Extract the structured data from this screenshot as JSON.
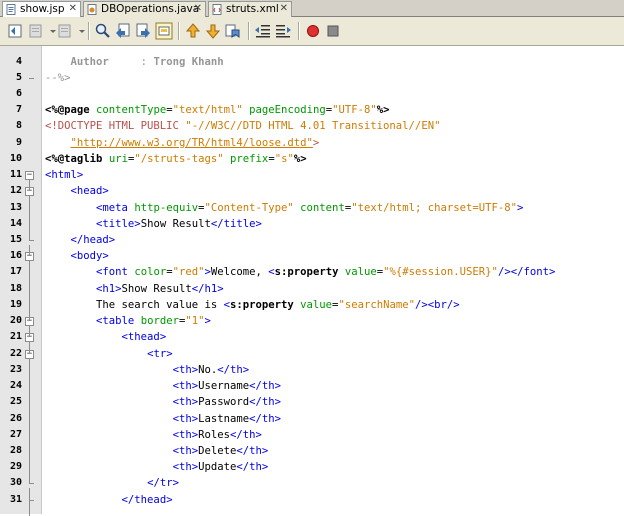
{
  "tabs": [
    {
      "label": "show.jsp",
      "active": true
    },
    {
      "label": "DBOperations.java",
      "active": false
    },
    {
      "label": "struts.xml",
      "active": false
    }
  ],
  "toolbar_icons": [
    "back-icon",
    "forward-icon",
    "down-arrow-icon",
    "find-icon",
    "find-prev-icon",
    "find-next-icon",
    "toggle-highlight-icon",
    "prev-bookmark-icon",
    "next-bookmark-icon",
    "toggle-bookmark-icon",
    "shift-left-icon",
    "shift-right-icon",
    "record-macro-icon",
    "stop-macro-icon"
  ],
  "colors": {
    "tag": "#0000e6",
    "attr": "#009900",
    "string": "#ce7b00",
    "comment": "#969696",
    "doctype": "#b8514a"
  },
  "lines": [
    {
      "n": "4",
      "segs": [
        [
          "c-com",
          "    "
        ],
        [
          "c-comb",
          "Author"
        ],
        [
          "c-com",
          "     : "
        ],
        [
          "c-comb",
          "Trong Khanh"
        ]
      ]
    },
    {
      "n": "5",
      "segs": [
        [
          "c-com",
          "--%>"
        ]
      ]
    },
    {
      "n": "6",
      "segs": []
    },
    {
      "n": "7",
      "segs": [
        [
          "c-dir",
          "<%@"
        ],
        [
          "c-el",
          "page"
        ],
        [
          "c-txt",
          " "
        ],
        [
          "c-attr",
          "contentType"
        ],
        [
          "c-txt",
          "="
        ],
        [
          "c-str",
          "\"text/html\""
        ],
        [
          "c-txt",
          " "
        ],
        [
          "c-attr",
          "pageEncoding"
        ],
        [
          "c-txt",
          "="
        ],
        [
          "c-str",
          "\"UTF-8\""
        ],
        [
          "c-dir",
          "%>"
        ]
      ]
    },
    {
      "n": "8",
      "segs": [
        [
          "c-dtd",
          "<!DOCTYPE HTML PUBLIC "
        ],
        [
          "c-str",
          "\"-//W3C//DTD HTML 4.01 Transitional//EN\""
        ]
      ]
    },
    {
      "n": "9",
      "segs": [
        [
          "c-txt",
          "    "
        ],
        [
          "c-url",
          "\"http://www.w3.org/TR/html4/loose.dtd\""
        ],
        [
          "c-dtd",
          ">"
        ]
      ]
    },
    {
      "n": "10",
      "segs": [
        [
          "c-dir",
          "<%@"
        ],
        [
          "c-el",
          "taglib"
        ],
        [
          "c-txt",
          " "
        ],
        [
          "c-attr",
          "uri"
        ],
        [
          "c-txt",
          "="
        ],
        [
          "c-str",
          "\"/struts-tags\""
        ],
        [
          "c-txt",
          " "
        ],
        [
          "c-attr",
          "prefix"
        ],
        [
          "c-txt",
          "="
        ],
        [
          "c-str",
          "\"s\""
        ],
        [
          "c-dir",
          "%>"
        ]
      ]
    },
    {
      "n": "11",
      "segs": [
        [
          "c-tag",
          "<html>"
        ]
      ]
    },
    {
      "n": "12",
      "segs": [
        [
          "c-txt",
          "    "
        ],
        [
          "c-tag",
          "<head>"
        ]
      ]
    },
    {
      "n": "13",
      "segs": [
        [
          "c-txt",
          "        "
        ],
        [
          "c-tag",
          "<meta"
        ],
        [
          "c-txt",
          " "
        ],
        [
          "c-attr",
          "http-equiv"
        ],
        [
          "c-txt",
          "="
        ],
        [
          "c-str",
          "\"Content-Type\""
        ],
        [
          "c-txt",
          " "
        ],
        [
          "c-attr",
          "content"
        ],
        [
          "c-txt",
          "="
        ],
        [
          "c-str",
          "\"text/html; charset=UTF-8\""
        ],
        [
          "c-tag",
          ">"
        ]
      ]
    },
    {
      "n": "14",
      "segs": [
        [
          "c-txt",
          "        "
        ],
        [
          "c-tag",
          "<title>"
        ],
        [
          "c-txt",
          "Show Result"
        ],
        [
          "c-tag",
          "</title>"
        ]
      ]
    },
    {
      "n": "15",
      "segs": [
        [
          "c-txt",
          "    "
        ],
        [
          "c-tag",
          "</head>"
        ]
      ]
    },
    {
      "n": "16",
      "segs": [
        [
          "c-txt",
          "    "
        ],
        [
          "c-tag",
          "<body>"
        ]
      ]
    },
    {
      "n": "17",
      "segs": [
        [
          "c-txt",
          "        "
        ],
        [
          "c-tag",
          "<font"
        ],
        [
          "c-txt",
          " "
        ],
        [
          "c-attr",
          "color"
        ],
        [
          "c-txt",
          "="
        ],
        [
          "c-str",
          "\"red\""
        ],
        [
          "c-tag",
          ">"
        ],
        [
          "c-txt",
          "Welcome, "
        ],
        [
          "c-tag",
          "<"
        ],
        [
          "c-el",
          "s:property"
        ],
        [
          "c-txt",
          " "
        ],
        [
          "c-attr",
          "value"
        ],
        [
          "c-txt",
          "="
        ],
        [
          "c-str",
          "\"%{#session.USER}\""
        ],
        [
          "c-tag",
          "/>"
        ],
        [
          "c-tag",
          "</font>"
        ]
      ]
    },
    {
      "n": "18",
      "segs": [
        [
          "c-txt",
          "        "
        ],
        [
          "c-tag",
          "<h1>"
        ],
        [
          "c-txt",
          "Show Result"
        ],
        [
          "c-tag",
          "</h1>"
        ]
      ]
    },
    {
      "n": "19",
      "segs": [
        [
          "c-txt",
          "        The search value is "
        ],
        [
          "c-tag",
          "<"
        ],
        [
          "c-el",
          "s:property"
        ],
        [
          "c-txt",
          " "
        ],
        [
          "c-attr",
          "value"
        ],
        [
          "c-txt",
          "="
        ],
        [
          "c-str",
          "\"searchName\""
        ],
        [
          "c-tag",
          "/>"
        ],
        [
          "c-tag",
          "<br/>"
        ]
      ]
    },
    {
      "n": "20",
      "segs": [
        [
          "c-txt",
          "        "
        ],
        [
          "c-tag",
          "<table"
        ],
        [
          "c-txt",
          " "
        ],
        [
          "c-attr",
          "border"
        ],
        [
          "c-txt",
          "="
        ],
        [
          "c-str",
          "\"1\""
        ],
        [
          "c-tag",
          ">"
        ]
      ]
    },
    {
      "n": "21",
      "segs": [
        [
          "c-txt",
          "            "
        ],
        [
          "c-tag",
          "<thead>"
        ]
      ]
    },
    {
      "n": "22",
      "segs": [
        [
          "c-txt",
          "                "
        ],
        [
          "c-tag",
          "<tr>"
        ]
      ]
    },
    {
      "n": "23",
      "segs": [
        [
          "c-txt",
          "                    "
        ],
        [
          "c-tag",
          "<th>"
        ],
        [
          "c-txt",
          "No."
        ],
        [
          "c-tag",
          "</th>"
        ]
      ]
    },
    {
      "n": "24",
      "segs": [
        [
          "c-txt",
          "                    "
        ],
        [
          "c-tag",
          "<th>"
        ],
        [
          "c-txt",
          "Username"
        ],
        [
          "c-tag",
          "</th>"
        ]
      ]
    },
    {
      "n": "25",
      "segs": [
        [
          "c-txt",
          "                    "
        ],
        [
          "c-tag",
          "<th>"
        ],
        [
          "c-txt",
          "Password"
        ],
        [
          "c-tag",
          "</th>"
        ]
      ]
    },
    {
      "n": "26",
      "segs": [
        [
          "c-txt",
          "                    "
        ],
        [
          "c-tag",
          "<th>"
        ],
        [
          "c-txt",
          "Lastname"
        ],
        [
          "c-tag",
          "</th>"
        ]
      ]
    },
    {
      "n": "27",
      "segs": [
        [
          "c-txt",
          "                    "
        ],
        [
          "c-tag",
          "<th>"
        ],
        [
          "c-txt",
          "Roles"
        ],
        [
          "c-tag",
          "</th>"
        ]
      ]
    },
    {
      "n": "28",
      "segs": [
        [
          "c-txt",
          "                    "
        ],
        [
          "c-tag",
          "<th>"
        ],
        [
          "c-txt",
          "Delete"
        ],
        [
          "c-tag",
          "</th>"
        ]
      ]
    },
    {
      "n": "29",
      "segs": [
        [
          "c-txt",
          "                    "
        ],
        [
          "c-tag",
          "<th>"
        ],
        [
          "c-txt",
          "Update"
        ],
        [
          "c-tag",
          "</th>"
        ]
      ]
    },
    {
      "n": "30",
      "segs": [
        [
          "c-txt",
          "                "
        ],
        [
          "c-tag",
          "</tr>"
        ]
      ]
    },
    {
      "n": "31",
      "segs": [
        [
          "c-txt",
          "            "
        ],
        [
          "c-tag",
          "</thead>"
        ]
      ]
    }
  ]
}
